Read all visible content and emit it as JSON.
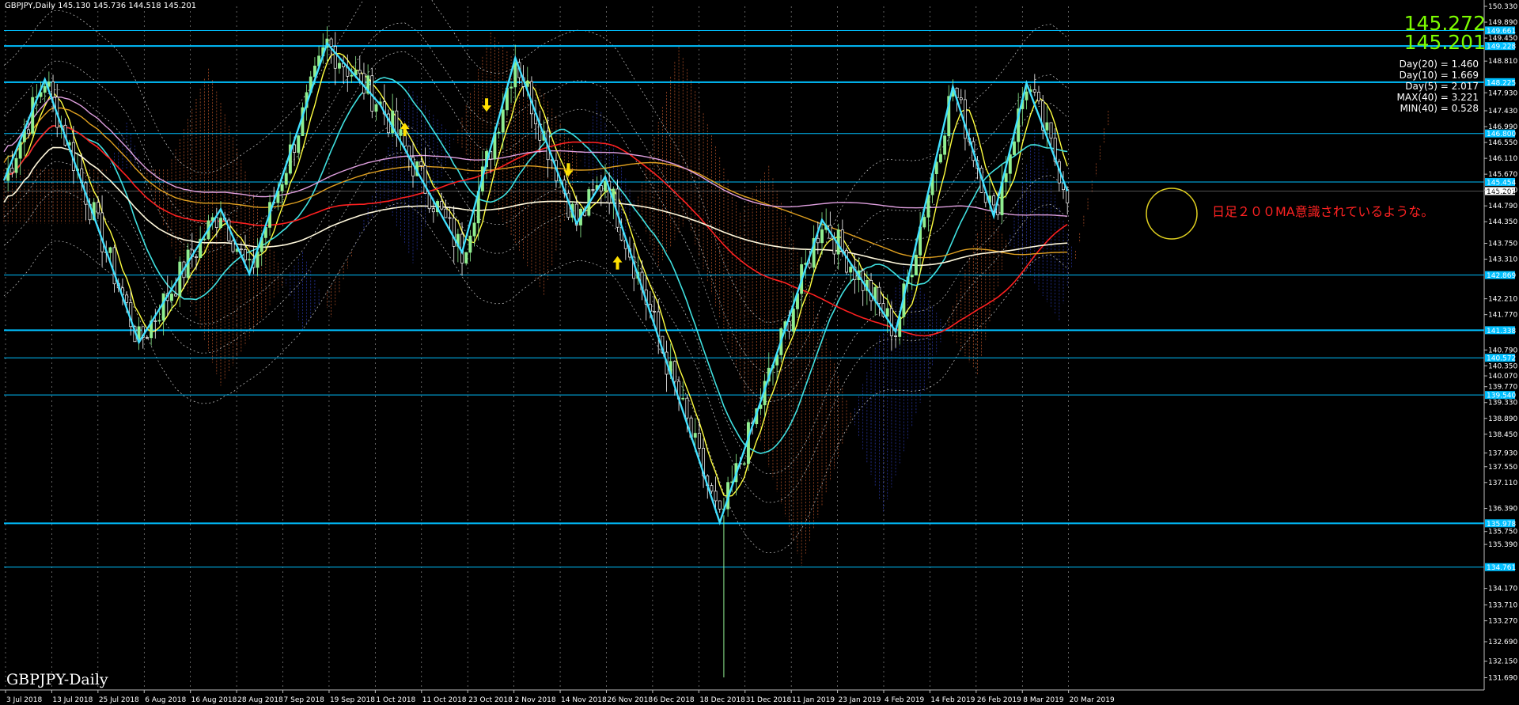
{
  "header": {
    "symbol_info": "GBPJPY,Daily  145.130 145.736 144.518 145.201"
  },
  "watermark": "GBPJPY-Daily",
  "bid_price": "145.272",
  "ask_price": "145.201",
  "stats": [
    "Day(20) = 1.460",
    "Day(10) = 1.669",
    "Day(5) = 2.017",
    "MAX(40) = 3.221",
    "MIN(40) = 0.528"
  ],
  "annotation": "日足２００MA意識されているような。",
  "colors": {
    "background": "#000000",
    "bull": "#90EE90",
    "bear": "#FFFFFF",
    "level_line": "#00BFFF",
    "zigzag": "#40E0FF",
    "price_big": "#7CFC00",
    "annotation": "#FF2222",
    "ma_red": "#FF2020",
    "ma_yellow": "#FFFF40",
    "ma_orange": "#E0A020",
    "ma_pink": "#E0A0E0",
    "ma_cream": "#FFF8DC",
    "cloud_up": "#3040C0",
    "cloud_down": "#D06030"
  },
  "chart_data": {
    "type": "candlestick",
    "title": "GBPJPY,Daily",
    "ylim": [
      131.35,
      150.33
    ],
    "y_ticks": [
      "150.330",
      "149.890",
      "149.450",
      "148.810",
      "148.370",
      "147.930",
      "147.430",
      "146.990",
      "146.550",
      "146.110",
      "145.670",
      "145.230",
      "144.790",
      "144.350",
      "143.750",
      "143.310",
      "142.870",
      "142.210",
      "141.770",
      "141.330",
      "140.790",
      "140.350",
      "140.070",
      "139.770",
      "139.330",
      "138.890",
      "138.450",
      "137.930",
      "137.550",
      "137.110",
      "136.390",
      "136.110",
      "135.750",
      "135.390",
      "134.760",
      "134.170",
      "133.710",
      "133.270",
      "132.690",
      "132.150",
      "131.690"
    ],
    "x_ticks": [
      "3 Jul 2018",
      "13 Jul 2018",
      "25 Jul 2018",
      "6 Aug 2018",
      "16 Aug 2018",
      "28 Aug 2018",
      "7 Sep 2018",
      "19 Sep 2018",
      "1 Oct 2018",
      "11 Oct 2018",
      "23 Oct 2018",
      "2 Nov 2018",
      "14 Nov 2018",
      "26 Nov 2018",
      "6 Dec 2018",
      "18 Dec 2018",
      "31 Dec 2018",
      "11 Jan 2019",
      "23 Jan 2019",
      "4 Feb 2019",
      "14 Feb 2019",
      "26 Feb 2019",
      "8 Mar 2019",
      "20 Mar 2019"
    ],
    "horizontal_levels": [
      {
        "price": 149.661,
        "label": "149.661"
      },
      {
        "price": 149.228,
        "label": "149.228"
      },
      {
        "price": 148.225,
        "label": "148.225"
      },
      {
        "price": 146.8,
        "label": "146.800"
      },
      {
        "price": 145.454,
        "label": "145.454"
      },
      {
        "price": 142.869,
        "label": "142.869"
      },
      {
        "price": 141.338,
        "label": "141.338"
      },
      {
        "price": 140.572,
        "label": "140.572"
      },
      {
        "price": 139.54,
        "label": "139.540"
      },
      {
        "price": 135.978,
        "label": "135.978"
      },
      {
        "price": 134.761,
        "label": "134.761"
      }
    ],
    "current_price": {
      "price": 145.201,
      "label": "145.201"
    },
    "zigzag": [
      {
        "x": 0,
        "y": 145.5
      },
      {
        "x": 10,
        "y": 148.3
      },
      {
        "x": 33,
        "y": 141.0
      },
      {
        "x": 53,
        "y": 144.7
      },
      {
        "x": 60,
        "y": 142.9
      },
      {
        "x": 79,
        "y": 149.3
      },
      {
        "x": 92,
        "y": 147.6
      },
      {
        "x": 112,
        "y": 143.5
      },
      {
        "x": 125,
        "y": 148.9
      },
      {
        "x": 140,
        "y": 144.3
      },
      {
        "x": 147,
        "y": 145.6
      },
      {
        "x": 175,
        "y": 136.0
      },
      {
        "x": 200,
        "y": 144.4
      },
      {
        "x": 218,
        "y": 141.3
      },
      {
        "x": 232,
        "y": 148.1
      },
      {
        "x": 242,
        "y": 144.5
      },
      {
        "x": 250,
        "y": 148.2
      },
      {
        "x": 260,
        "y": 145.2
      }
    ],
    "arrows": [
      {
        "x": 98,
        "y": 146.9,
        "dir": "up"
      },
      {
        "x": 118,
        "y": 147.6,
        "dir": "down"
      },
      {
        "x": 138,
        "y": 145.8,
        "dir": "down"
      },
      {
        "x": 150,
        "y": 143.2,
        "dir": "up"
      }
    ]
  }
}
